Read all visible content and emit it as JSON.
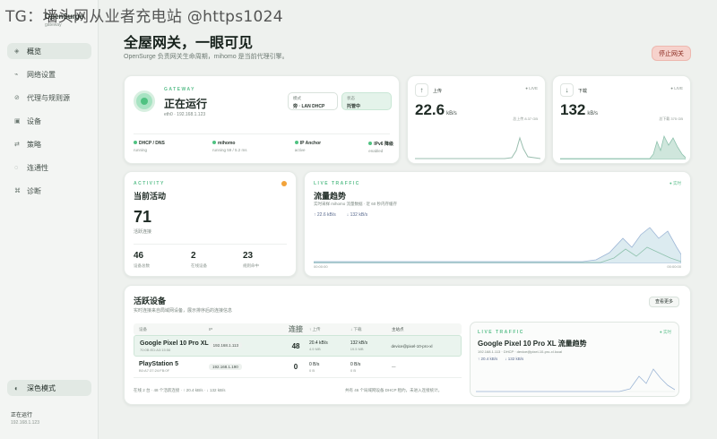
{
  "watermark": "TG：墙头网从业者充电站 @https1024",
  "sidebar": {
    "brand": "OpenSurge",
    "brand_sub": "gateway",
    "items": [
      {
        "icon": "◈",
        "label": "概览"
      },
      {
        "icon": "⌁",
        "label": "网络设置"
      },
      {
        "icon": "⊘",
        "label": "代理与规则源"
      },
      {
        "icon": "▣",
        "label": "设备"
      },
      {
        "icon": "⇄",
        "label": "策略"
      },
      {
        "icon": "◌",
        "label": "连通性"
      },
      {
        "icon": "⌘",
        "label": "诊断"
      }
    ],
    "dark_mode_label": "深色模式",
    "status": "正在运行",
    "status_ip": "192.168.1.123"
  },
  "header": {
    "title": "全屋网关，一眼可见",
    "subtitle": "OpenSurge 负责网关生命周期，mihomo 是当前代理引擎。",
    "stop_label": "停止网关"
  },
  "gateway": {
    "kicker": "GATEWAY",
    "title": "正在运行",
    "ip": "eth0 · 192.168.1.123",
    "pill1_label": "模式",
    "pill1_value": "旁 · LAN DHCP",
    "pill2_label": "状态",
    "pill2_value": "托管中",
    "features": [
      {
        "title": "DHCP / DNS",
        "sub": "running"
      },
      {
        "title": "mihomo",
        "sub": "running 59 / 5.2 ms"
      },
      {
        "title": "IP Anchor",
        "sub": "active"
      },
      {
        "title": "IPv6 降级",
        "sub": "enabled"
      }
    ]
  },
  "upload": {
    "icon": "↑",
    "label": "上传",
    "tag": "● LIVE",
    "value": "22.6",
    "unit": "kB/s",
    "foot": "总上传 8.37 GB"
  },
  "download": {
    "icon": "↓",
    "label": "下载",
    "tag": "● LIVE",
    "value": "132",
    "unit": "kB/s",
    "foot": "总下载 375 GB"
  },
  "activity": {
    "kicker": "ACTIVITY",
    "title": "当前活动",
    "big_value": "71",
    "big_label": "活跃连接",
    "stats": [
      {
        "value": "46",
        "label": "设备总数"
      },
      {
        "value": "2",
        "label": "在线设备"
      },
      {
        "value": "23",
        "label": "规则命中"
      }
    ]
  },
  "live_traffic": {
    "kicker": "LIVE TRAFFIC",
    "title": "流量趋势",
    "subtitle": "实时采样 mihomo 流量数据 · 近 60 秒内存缓存",
    "legend_up": "↑ 22.6 kB/s",
    "legend_down": "↓ 132 kB/s",
    "live": "● 实时",
    "time_start": "00:00:00",
    "time_end": "00:00:00"
  },
  "devices": {
    "title": "活跃设备",
    "subtitle": "实时连接来自局域网设备，展示排序后的连接信息",
    "button": "查看更多",
    "headers": [
      "设备",
      "IP",
      "连接",
      "↑ 上传",
      "↓ 下载",
      "主站点"
    ],
    "rows": [
      {
        "name": "Google Pixel 10 Pro XL",
        "mac": "70:0B:ED:A3:15:56",
        "ip": "192.168.1.113",
        "conn": "48",
        "up": "20.4 kB/s",
        "up_sub": "4.9 MB",
        "down": "132 kB/s",
        "down_sub": "19.5 MB",
        "host": "device@pixel-10-pro-xl"
      },
      {
        "name": "PlayStation 5",
        "mac": "B0:A7:37:24:FB:0F",
        "ip": "192.168.1.190",
        "conn": "0",
        "up": "0 B/s",
        "up_sub": "0 B",
        "down": "0 B/s",
        "down_sub": "0 B",
        "host": "—"
      }
    ],
    "footer_left": "在线 2 台 · 48 个活跃连接 · ↑ 20.4 kB/s · ↓ 132 kB/s",
    "footer_right": "共有 46 个局域网设备 DHCP 租约，未进入连接统计。"
  },
  "device_traffic": {
    "kicker": "LIVE TRAFFIC",
    "title": "Google Pixel 10 Pro XL 流量趋势",
    "subtitle": "192.168.1.113 · DHCP · device@pixel-10-pro-xl.local",
    "legend_up": "↑ 20.4 kB/s",
    "legend_down": "↓ 132 kB/s",
    "live": "● 实时"
  }
}
